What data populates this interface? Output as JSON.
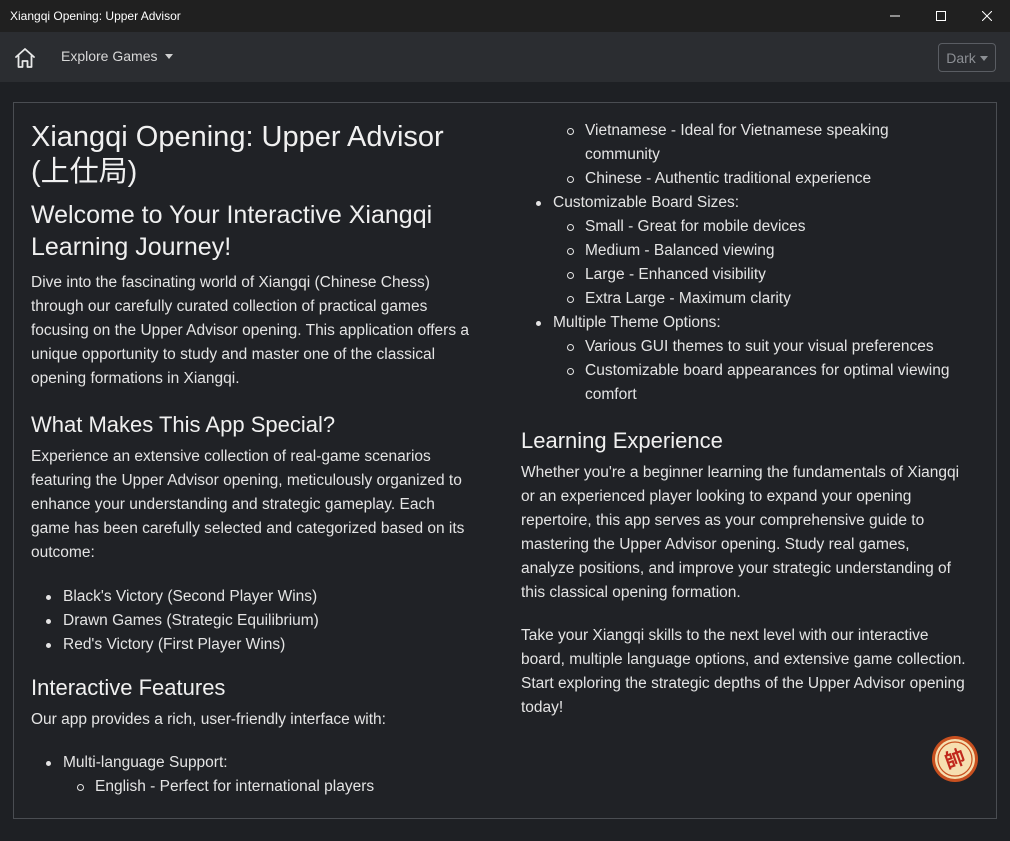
{
  "window": {
    "title": "Xiangqi Opening: Upper Advisor"
  },
  "navbar": {
    "home_icon": "home-icon",
    "explore_label": "Explore Games",
    "theme_label": "Dark"
  },
  "content": {
    "title_line1": "Xiangqi Opening: Upper Advisor",
    "title_line2": "(上仕局)",
    "welcome_line1": "Welcome to Your Interactive Xiangqi",
    "welcome_line2": "Learning Journey!",
    "intro_lines": [
      "Dive into the fascinating world of Xiangqi (Chinese Chess)",
      "through our carefully curated collection of practical games",
      "focusing on the Upper Advisor opening. This application offers a",
      "unique opportunity to study and master one of the classical",
      "opening formations in Xiangqi."
    ],
    "special_heading": "What Makes This App Special?",
    "special_lines": [
      "Experience an extensive collection of real-game scenarios",
      "featuring the Upper Advisor opening, meticulously organized to",
      "enhance your understanding and strategic gameplay. Each",
      "game has been carefully selected and categorized based on its",
      "outcome:"
    ],
    "outcomes": [
      "Black's Victory (Second Player Wins)",
      "Drawn Games (Strategic Equilibrium)",
      "Red's Victory (First Player Wins)"
    ],
    "features_heading": "Interactive Features",
    "features_intro": "Our app provides a rich, user-friendly interface with:",
    "multilang_label": "Multi-language Support:",
    "lang_english": "English - Perfect for international players",
    "lang_vietnamese_1": "Vietnamese - Ideal for Vietnamese speaking",
    "lang_vietnamese_2": "community",
    "lang_chinese": "Chinese - Authentic traditional experience",
    "board_sizes_label": "Customizable Board Sizes:",
    "board_sizes": [
      "Small - Great for mobile devices",
      "Medium - Balanced viewing",
      "Large - Enhanced visibility",
      "Extra Large - Maximum clarity"
    ],
    "themes_label": "Multiple Theme Options:",
    "theme_gui": "Various GUI themes to suit your visual preferences",
    "theme_board_1": "Customizable board appearances for optimal viewing",
    "theme_board_2": "comfort",
    "learning_heading": "Learning Experience",
    "learning_lines": [
      "Whether you're a beginner learning the fundamentals of Xiangqi",
      "or an experienced player looking to expand your opening",
      "repertoire, this app serves as your comprehensive guide to",
      "mastering the Upper Advisor opening. Study real games,",
      "analyze positions, and improve your strategic understanding of",
      "this classical opening formation."
    ],
    "closing_lines": [
      "Take your Xiangqi skills to the next level with our interactive",
      "board, multiple language options, and extensive game collection.",
      "Start exploring the strategic depths of the Upper Advisor opening",
      "today!"
    ]
  },
  "logo": {
    "icon": "xiangqi-piece-logo",
    "glyph": "帥"
  }
}
